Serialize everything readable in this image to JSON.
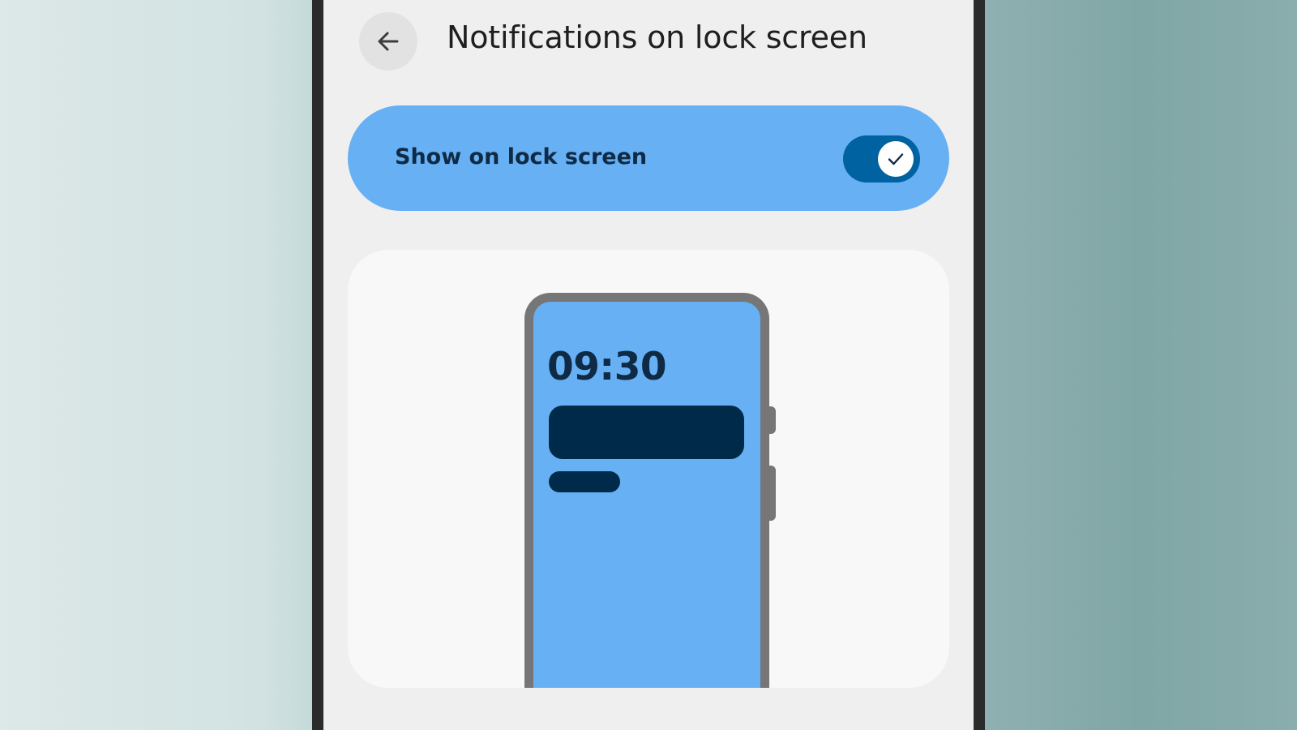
{
  "header": {
    "back_icon": "arrow-left-icon",
    "title": "Notifications on lock screen"
  },
  "lock_screen_toggle": {
    "label": "Show on lock screen",
    "state": "on",
    "thumb_icon": "check-icon"
  },
  "preview": {
    "clock": "09:30"
  },
  "colors": {
    "accent_container": "#66b0f3",
    "switch_track_on": "#0062a0",
    "on_accent_text": "#0f2a45",
    "notification_block": "#002a4a",
    "screen_background": "#efefef",
    "card_background": "#f8f8f8"
  }
}
